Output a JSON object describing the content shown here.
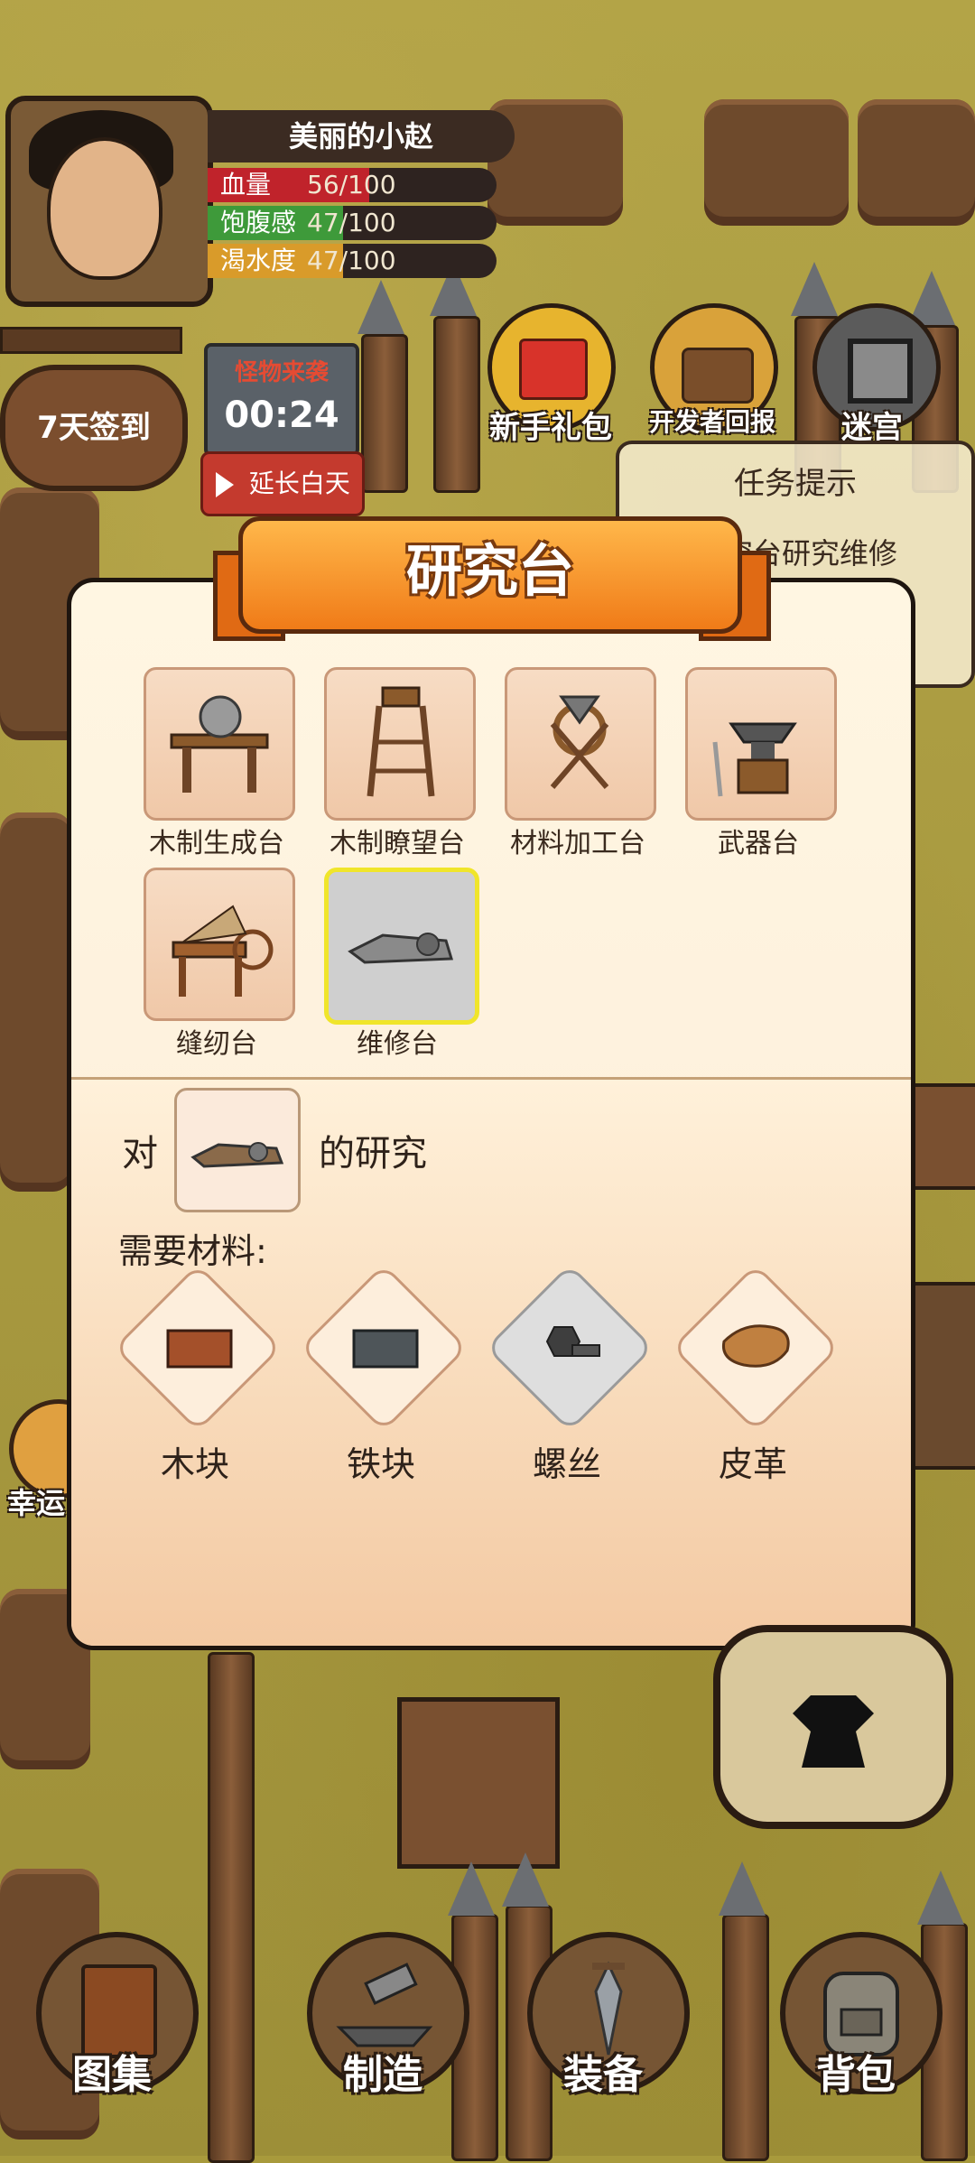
{
  "player": {
    "name": "美丽的小赵"
  },
  "stats": [
    {
      "label": "血量",
      "value": "56/100",
      "color": "#c0232b",
      "fraction": 0.56
    },
    {
      "label": "饱腹感",
      "value": "47/100",
      "color": "#3e9a3a",
      "fraction": 0.47
    },
    {
      "label": "渴水度",
      "value": "47/100",
      "color": "#d99b2a",
      "fraction": 0.47
    }
  ],
  "checkin": {
    "label": "7天签到"
  },
  "monster": {
    "title": "怪物来袭",
    "countdown": "00:24"
  },
  "extend_day": {
    "label": "延长白天"
  },
  "top_buttons": {
    "gift": "新手礼包",
    "dev": "开发者回报",
    "maze": "迷宫"
  },
  "task_hint": {
    "title": "任务提示",
    "body": "研究台研究维修"
  },
  "luck": {
    "label": "幸运"
  },
  "modal": {
    "title": "研究台",
    "tiles": [
      {
        "label": "木制生成台",
        "icon": "wood-generator-icon"
      },
      {
        "label": "木制瞭望台",
        "icon": "watchtower-icon"
      },
      {
        "label": "材料加工台",
        "icon": "material-processor-icon"
      },
      {
        "label": "武器台",
        "icon": "anvil-icon"
      },
      {
        "label": "缝纫台",
        "icon": "sewing-table-icon"
      },
      {
        "label": "维修台",
        "icon": "repair-bench-icon"
      }
    ],
    "research_prefix": "对",
    "research_suffix": "的研究",
    "materials_heading": "需要材料:",
    "materials": [
      {
        "label": "木块",
        "icon": "wood-block-icon"
      },
      {
        "label": "铁块",
        "icon": "iron-block-icon"
      },
      {
        "label": "螺丝",
        "icon": "screw-icon"
      },
      {
        "label": "皮革",
        "icon": "leather-icon"
      }
    ]
  },
  "bottom_nav": {
    "atlas": "图集",
    "craft": "制造",
    "equip": "装备",
    "bag": "背包"
  }
}
